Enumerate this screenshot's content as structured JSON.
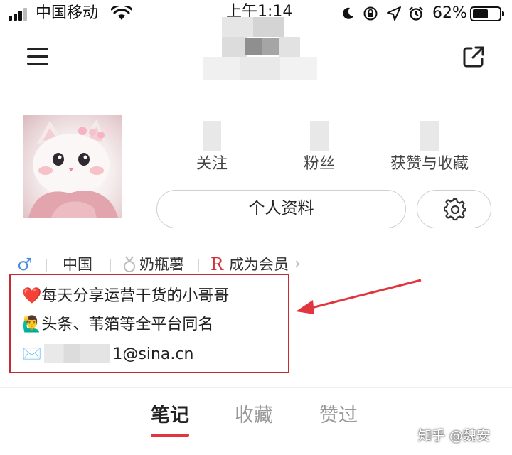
{
  "status_bar": {
    "carrier": "中国移动",
    "time": "上午1:14",
    "battery_percent": "62%",
    "battery_level": 0.62,
    "icons": [
      "signal-icon",
      "wifi-icon",
      "moon-icon",
      "rotation-lock-icon",
      "location-icon",
      "alarm-icon",
      "battery-icon"
    ]
  },
  "header": {
    "menu_icon": "hamburger-menu-icon",
    "share_icon": "external-share-icon"
  },
  "profile": {
    "stats": [
      {
        "label": "关注"
      },
      {
        "label": "粉丝"
      },
      {
        "label": "获赞与收藏"
      }
    ],
    "profile_button_label": "个人资料",
    "settings_icon": "gear-icon"
  },
  "info": {
    "gender_icon": "male-icon",
    "gender_symbol": "♂",
    "location": "中国",
    "level_icon": "medal-icon",
    "level_name": "奶瓶薯",
    "member_badge": "R",
    "member_label": "成为会员",
    "member_chevron": "›"
  },
  "bio": {
    "lines": [
      {
        "emoji": "❤️",
        "text": "每天分享运营干货的小哥哥"
      },
      {
        "emoji": "🙋‍♂️",
        "text": "头条、苇箔等全平台同名"
      },
      {
        "emoji": "✉️",
        "text": "1@sina.cn"
      }
    ],
    "highlight_color": "#c62a32"
  },
  "tabs": [
    {
      "label": "笔记",
      "active": true
    },
    {
      "label": "收藏",
      "active": false
    },
    {
      "label": "赞过",
      "active": false
    }
  ],
  "accent_color": "#e0363f",
  "watermark": "知乎 @魏安"
}
